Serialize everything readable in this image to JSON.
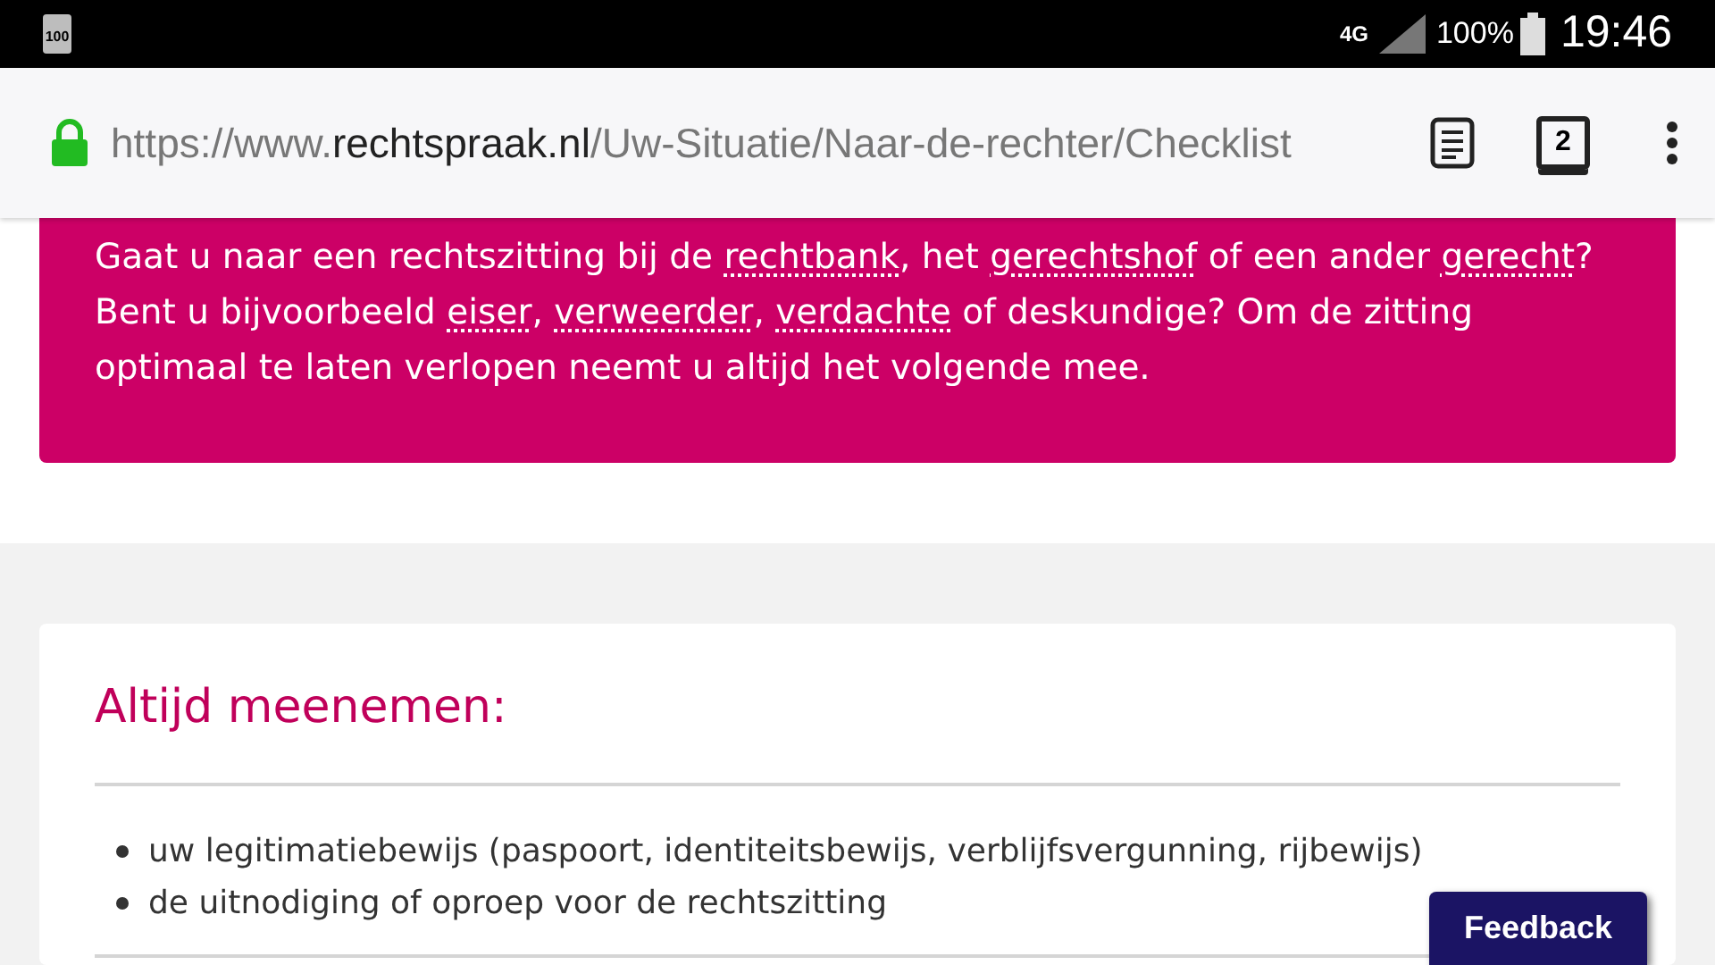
{
  "status_bar": {
    "battery_badge": "100",
    "network": "4G",
    "battery_percent": "100%",
    "time": "19:46"
  },
  "address_bar": {
    "url_parts": [
      {
        "text": "https://www.",
        "kind": "muted"
      },
      {
        "text": "rechtspraak.nl",
        "kind": "domain"
      },
      {
        "text": "/Uw-Situatie/Naar-de-rechter/Checklist",
        "kind": "muted"
      }
    ],
    "tab_count": "2"
  },
  "intro": {
    "lines": [
      {
        "lead": "Gaat u naar een rechtszitting bij de ",
        "links": [
          {
            "term": "rechtbank",
            "after": ", het "
          },
          {
            "term": "gerechtshof",
            "after": " of een ander "
          },
          {
            "term": "gerecht",
            "after": "?"
          }
        ]
      },
      {
        "lead": "Bent u bijvoorbeeld ",
        "links": [
          {
            "term": "eiser",
            "after": ", "
          },
          {
            "term": "verweerder",
            "after": ", "
          },
          {
            "term": "verdachte",
            "after": " of deskundige? Om de zitting"
          }
        ]
      },
      {
        "lead": "optimaal te laten verlopen neemt u altijd het volgende mee."
      }
    ]
  },
  "section": {
    "title": "Altijd meenemen:",
    "items": [
      "uw legitimatiebewijs (paspoort, identiteitsbewijs, verblijfsvergunning, rijbewijs)",
      "de uitnodiging of oproep voor de rechtszitting"
    ]
  },
  "feedback_button": "Feedback"
}
